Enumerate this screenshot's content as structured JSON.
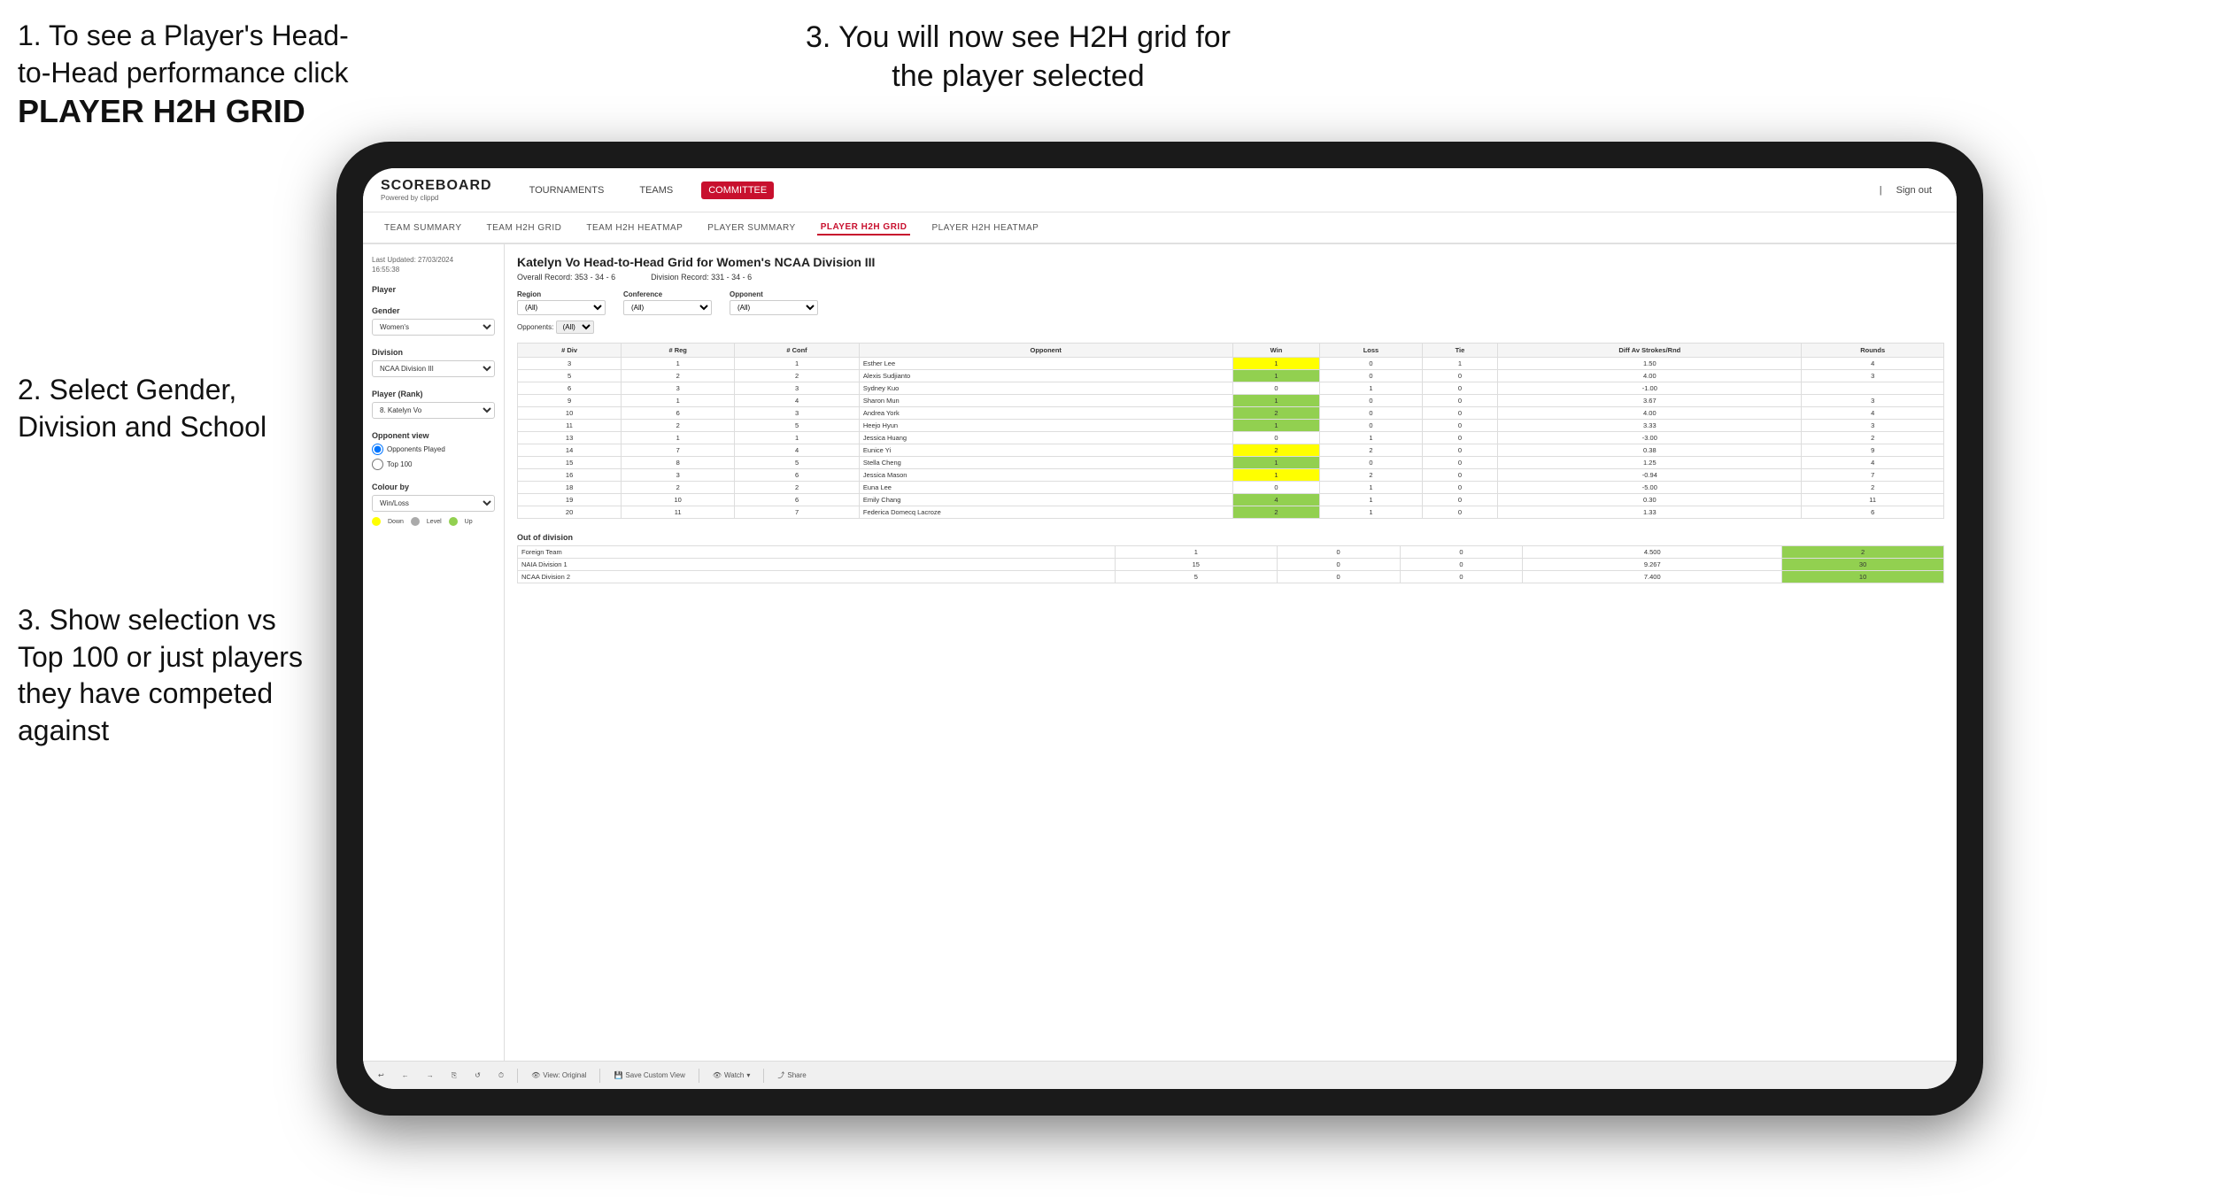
{
  "instructions": {
    "top_left_1": "1. To see a Player's Head-to-Head performance click",
    "top_left_bold": "PLAYER H2H GRID",
    "top_right": "3. You will now see H2H grid for the player selected",
    "mid_left": "2. Select Gender, Division and School",
    "bottom_left_1": "3. Show selection vs Top 100 or just players they have competed against"
  },
  "nav": {
    "logo": "SCOREBOARD",
    "logo_sub": "Powered by clippd",
    "items": [
      "TOURNAMENTS",
      "TEAMS",
      "COMMITTEE"
    ],
    "sign_out": "Sign out"
  },
  "sub_nav": {
    "items": [
      "TEAM SUMMARY",
      "TEAM H2H GRID",
      "TEAM H2H HEATMAP",
      "PLAYER SUMMARY",
      "PLAYER H2H GRID",
      "PLAYER H2H HEATMAP"
    ]
  },
  "left_panel": {
    "last_updated_label": "Last Updated: 27/03/2024",
    "last_updated_time": "16:55:38",
    "player_label": "Player",
    "gender_label": "Gender",
    "gender_value": "Women's",
    "division_label": "Division",
    "division_value": "NCAA Division III",
    "player_rank_label": "Player (Rank)",
    "player_rank_value": "8. Katelyn Vo",
    "opponent_view_label": "Opponent view",
    "opponent_radio_1": "Opponents Played",
    "opponent_radio_2": "Top 100",
    "colour_by_label": "Colour by",
    "colour_by_value": "Win/Loss",
    "legend": {
      "down": "Down",
      "level": "Level",
      "up": "Up"
    }
  },
  "main": {
    "title": "Katelyn Vo Head-to-Head Grid for Women's NCAA Division III",
    "overall_record_label": "Overall Record:",
    "overall_record_value": "353 - 34 - 6",
    "division_record_label": "Division Record:",
    "division_record_value": "331 - 34 - 6",
    "region_label": "Region",
    "conference_label": "Conference",
    "opponent_label": "Opponent",
    "opponents_label": "Opponents:",
    "region_filter": "(All)",
    "conference_filter": "(All)",
    "opponent_filter": "(All)",
    "table_headers": [
      "# Div",
      "# Reg",
      "# Conf",
      "Opponent",
      "Win",
      "Loss",
      "Tie",
      "Diff Av Strokes/Rnd",
      "Rounds"
    ],
    "rows": [
      {
        "div": "3",
        "reg": "1",
        "conf": "1",
        "opponent": "Esther Lee",
        "win": 1,
        "loss": 0,
        "tie": 1,
        "diff": "1.50",
        "rounds": 4,
        "win_color": "yellow",
        "tie_color": ""
      },
      {
        "div": "5",
        "reg": "2",
        "conf": "2",
        "opponent": "Alexis Sudjianto",
        "win": 1,
        "loss": 0,
        "tie": 0,
        "diff": "4.00",
        "rounds": 3,
        "win_color": "green",
        "tie_color": ""
      },
      {
        "div": "6",
        "reg": "3",
        "conf": "3",
        "opponent": "Sydney Kuo",
        "win": 0,
        "loss": 1,
        "tie": 0,
        "diff": "-1.00",
        "rounds": "",
        "win_color": "",
        "tie_color": ""
      },
      {
        "div": "9",
        "reg": "1",
        "conf": "4",
        "opponent": "Sharon Mun",
        "win": 1,
        "loss": 0,
        "tie": 0,
        "diff": "3.67",
        "rounds": 3,
        "win_color": "green",
        "tie_color": ""
      },
      {
        "div": "10",
        "reg": "6",
        "conf": "3",
        "opponent": "Andrea York",
        "win": 2,
        "loss": 0,
        "tie": 0,
        "diff": "4.00",
        "rounds": 4,
        "win_color": "green",
        "tie_color": ""
      },
      {
        "div": "11",
        "reg": "2",
        "conf": "5",
        "opponent": "Heejo Hyun",
        "win": 1,
        "loss": 0,
        "tie": 0,
        "diff": "3.33",
        "rounds": 3,
        "win_color": "green",
        "tie_color": ""
      },
      {
        "div": "13",
        "reg": "1",
        "conf": "1",
        "opponent": "Jessica Huang",
        "win": 0,
        "loss": 1,
        "tie": 0,
        "diff": "-3.00",
        "rounds": 2,
        "win_color": "",
        "tie_color": ""
      },
      {
        "div": "14",
        "reg": "7",
        "conf": "4",
        "opponent": "Eunice Yi",
        "win": 2,
        "loss": 2,
        "tie": 0,
        "diff": "0.38",
        "rounds": 9,
        "win_color": "yellow",
        "tie_color": ""
      },
      {
        "div": "15",
        "reg": "8",
        "conf": "5",
        "opponent": "Stella Cheng",
        "win": 1,
        "loss": 0,
        "tie": 0,
        "diff": "1.25",
        "rounds": 4,
        "win_color": "green",
        "tie_color": ""
      },
      {
        "div": "16",
        "reg": "3",
        "conf": "6",
        "opponent": "Jessica Mason",
        "win": 1,
        "loss": 2,
        "tie": 0,
        "diff": "-0.94",
        "rounds": 7,
        "win_color": "yellow",
        "tie_color": ""
      },
      {
        "div": "18",
        "reg": "2",
        "conf": "2",
        "opponent": "Euna Lee",
        "win": 0,
        "loss": 1,
        "tie": 0,
        "diff": "-5.00",
        "rounds": 2,
        "win_color": "",
        "tie_color": ""
      },
      {
        "div": "19",
        "reg": "10",
        "conf": "6",
        "opponent": "Emily Chang",
        "win": 4,
        "loss": 1,
        "tie": 0,
        "diff": "0.30",
        "rounds": 11,
        "win_color": "green",
        "tie_color": ""
      },
      {
        "div": "20",
        "reg": "11",
        "conf": "7",
        "opponent": "Federica Domecq Lacroze",
        "win": 2,
        "loss": 1,
        "tie": 0,
        "diff": "1.33",
        "rounds": 6,
        "win_color": "green",
        "tie_color": ""
      }
    ],
    "out_of_division_label": "Out of division",
    "out_of_division_rows": [
      {
        "label": "Foreign Team",
        "win": 1,
        "loss": 0,
        "tie": 0,
        "diff": "4.500",
        "rounds": 2
      },
      {
        "label": "NAIA Division 1",
        "win": 15,
        "loss": 0,
        "tie": 0,
        "diff": "9.267",
        "rounds": 30
      },
      {
        "label": "NCAA Division 2",
        "win": 5,
        "loss": 0,
        "tie": 0,
        "diff": "7.400",
        "rounds": 10
      }
    ]
  },
  "toolbar": {
    "view_original": "View: Original",
    "save_custom": "Save Custom View",
    "watch": "Watch",
    "share": "Share"
  },
  "colors": {
    "active_nav": "#c8102e",
    "green": "#92d050",
    "yellow": "#ffff00",
    "orange": "#ffc000",
    "legend_down": "#ffff00",
    "legend_level": "#aaaaaa",
    "legend_up": "#92d050"
  }
}
